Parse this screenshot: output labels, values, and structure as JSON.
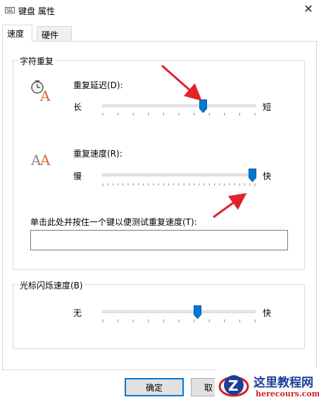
{
  "window": {
    "title": "键盘 属性",
    "close_glyph": "✕"
  },
  "tabs": [
    {
      "label": "速度",
      "active": true
    },
    {
      "label": "硬件",
      "active": false
    }
  ],
  "char_repeat": {
    "group_label": "字符重复",
    "delay": {
      "label": "重复延迟(D):",
      "min_label": "长",
      "max_label": "短",
      "value_fraction": 0.66
    },
    "rate": {
      "label": "重复速度(R):",
      "min_label": "慢",
      "max_label": "快",
      "value_fraction": 0.98
    },
    "test_label": "单击此处并按住一个键以便测试重复速度(T):",
    "test_value": ""
  },
  "cursor_blink": {
    "group_label": "光标闪烁速度(B)",
    "min_label": "无",
    "max_label": "快",
    "value_fraction": 0.62
  },
  "buttons": {
    "ok": "确定",
    "cancel": "取"
  },
  "watermark": {
    "title": "这里教程网",
    "subtitle": "herecours.com"
  },
  "colors": {
    "accent": "#0078d7",
    "arrow": "#e3222b"
  }
}
